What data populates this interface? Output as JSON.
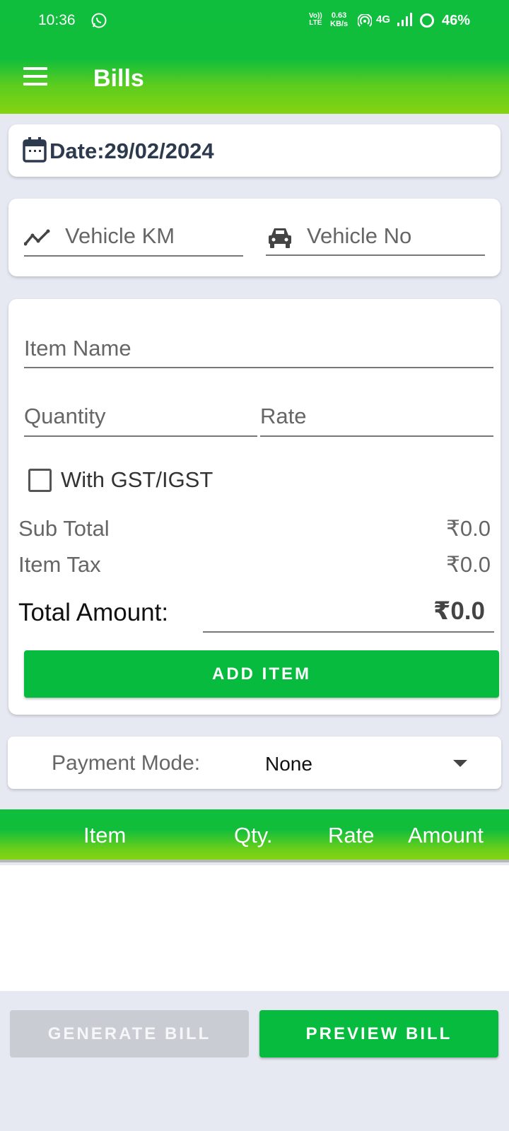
{
  "status_bar": {
    "time": "10:36",
    "volte_line1": "Vo))",
    "volte_line2": "LTE",
    "speed_value": "0.63",
    "speed_unit": "KB/s",
    "network": "4G",
    "battery": "46%"
  },
  "header": {
    "title": "Bills",
    "color": "#10be3c"
  },
  "date": {
    "text": "Date:29/02/2024"
  },
  "vehicle": {
    "km_placeholder": "Vehicle KM",
    "no_placeholder": "Vehicle No"
  },
  "item_form": {
    "item_name_placeholder": "Item Name",
    "quantity_placeholder": "Quantity",
    "rate_placeholder": "Rate",
    "gst_label": "With GST/IGST",
    "gst_checked": false,
    "sub_total_label": "Sub Total",
    "sub_total_value": "₹0.0",
    "item_tax_label": "Item Tax",
    "item_tax_value": "₹0.0",
    "total_label": "Total Amount:",
    "total_value": "₹0.0",
    "add_button": "ADD ITEM"
  },
  "payment": {
    "label": "Payment Mode:",
    "selected": "None"
  },
  "table": {
    "columns": [
      "Item",
      "Qty.",
      "Rate",
      "Amount"
    ],
    "rows": []
  },
  "actions": {
    "generate": "GENERATE BILL",
    "preview": "PREVIEW BILL"
  },
  "colors": {
    "accent": "#06bb3d",
    "disabled": "#c9ccd3",
    "background": "#e6e9f2"
  }
}
